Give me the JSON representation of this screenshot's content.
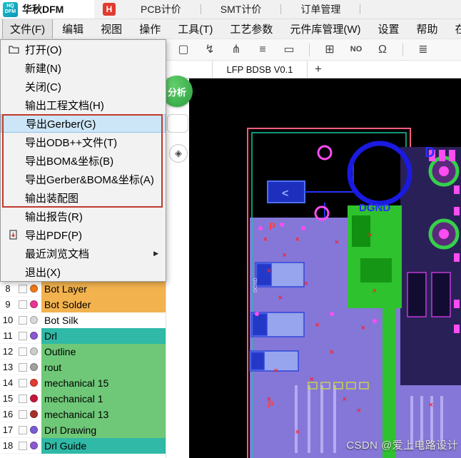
{
  "header": {
    "logo": {
      "line1": "HQ",
      "line2": "DFM"
    },
    "tabs": [
      {
        "label": "华秋DFM",
        "active": true
      },
      {
        "label": "PCB计价",
        "icon_letter": "H"
      },
      {
        "label": "SMT计价"
      },
      {
        "label": "订单管理"
      }
    ]
  },
  "menu_bar": {
    "items": [
      {
        "label": "文件(F)",
        "active": true
      },
      {
        "label": "编辑"
      },
      {
        "label": "视图"
      },
      {
        "label": "操作"
      },
      {
        "label": "工具(T)"
      },
      {
        "label": "工艺参数"
      },
      {
        "label": "元件库管理(W)"
      },
      {
        "label": "设置"
      },
      {
        "label": "帮助"
      },
      {
        "label": "在线客服"
      }
    ]
  },
  "file_menu": {
    "submenu_arrow": "▶",
    "items": [
      {
        "label": "打开(O)",
        "icon": "folder-open-icon"
      },
      {
        "label": "新建(N)"
      },
      {
        "label": "关闭(C)"
      },
      {
        "label": "输出工程文档(H)"
      },
      {
        "label": "导出Gerber(G)",
        "highlighted": true
      },
      {
        "label": "导出ODB++文件(T)"
      },
      {
        "label": "导出BOM&坐标(B)"
      },
      {
        "label": "导出Gerber&BOM&坐标(A)"
      },
      {
        "label": "输出装配图"
      },
      {
        "label": "输出报告(R)"
      },
      {
        "label": "导出PDF(P)",
        "icon": "pdf-export-icon"
      },
      {
        "label": "最近浏览文档",
        "has_submenu": true
      },
      {
        "label": "退出(X)"
      }
    ]
  },
  "toolbar": {
    "icons": [
      {
        "name": "board-outline-icon",
        "glyph": "▢"
      },
      {
        "name": "route-icon",
        "glyph": "↯"
      },
      {
        "name": "net-icon",
        "glyph": "⋔"
      },
      {
        "name": "netlist-icon",
        "glyph": "≡"
      },
      {
        "name": "measure-icon",
        "glyph": "▭"
      },
      {
        "name": "grid-icon",
        "glyph": "⊞"
      },
      {
        "name": "dfm-check-icon",
        "glyph": "NO"
      },
      {
        "name": "impedance-icon",
        "glyph": "Ω"
      },
      {
        "name": "layers-icon",
        "glyph": "≣"
      }
    ]
  },
  "side_tools": {
    "analysis_label": "分析",
    "layer_toggle_glyph": "◈"
  },
  "doc_tabs": {
    "active_tab": "LFP BDSB V0.1",
    "new_tab_label": "+"
  },
  "layers": {
    "rows": [
      {
        "num": "8",
        "name": "Bot Layer",
        "band": "#f2b24e",
        "dot": "#f07818"
      },
      {
        "num": "9",
        "name": "Bot Solder",
        "band": "#f2b24e",
        "dot": "#e8368f"
      },
      {
        "num": "10",
        "name": "Bot Silk",
        "band": "#ffffff",
        "dot": "#d8d8d8"
      },
      {
        "num": "11",
        "name": "Drl",
        "band": "#2fb9a6",
        "dot": "#8a5ad0"
      },
      {
        "num": "12",
        "name": "Outline",
        "band": "#6fc878",
        "dot": "#cccccc"
      },
      {
        "num": "13",
        "name": "rout",
        "band": "#6fc878",
        "dot": "#a0a0a0"
      },
      {
        "num": "14",
        "name": "mechanical 15",
        "band": "#6fc878",
        "dot": "#e23c30"
      },
      {
        "num": "15",
        "name": "mechanical 1",
        "band": "#6fc878",
        "dot": "#c2183a"
      },
      {
        "num": "16",
        "name": "mechanical 13",
        "band": "#6fc878",
        "dot": "#a8322a"
      },
      {
        "num": "17",
        "name": "Drl Drawing",
        "band": "#6fc878",
        "dot": "#7b5cd6"
      },
      {
        "num": "18",
        "name": "Drl Guide",
        "band": "#2fb9a6",
        "dot": "#8a5ad0"
      }
    ]
  },
  "pcb": {
    "labels": {
      "net": "DGND",
      "marker": "<",
      "corner": "D",
      "ref1": "P",
      "ref2": "P",
      "vlabel": "DGND"
    }
  },
  "watermark": "CSDN @爱上电路设计",
  "colors": {
    "accent_blue": "#2b2bff",
    "board_purple": "#8577d8",
    "board_green": "#2ec22e",
    "outline_pink": "#ff5d7e",
    "menu_highlight": "#cde6f7",
    "red_box": "#c0392b"
  }
}
